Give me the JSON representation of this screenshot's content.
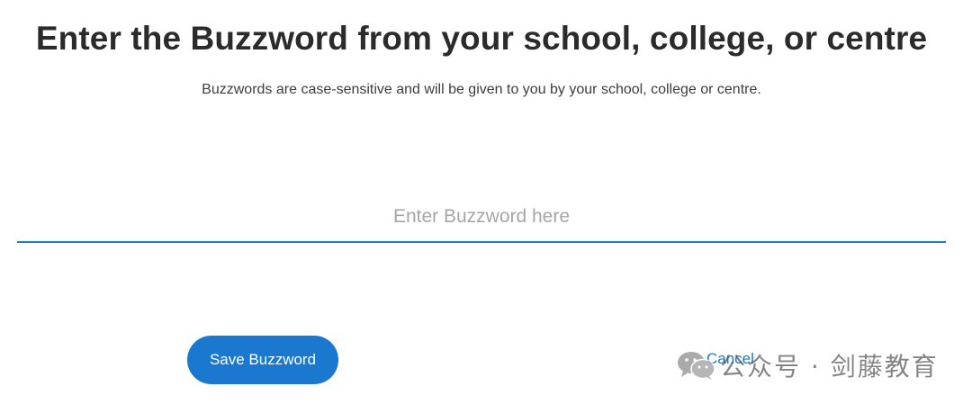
{
  "header": {
    "title": "Enter the Buzzword from your school, college, or centre",
    "subtitle": "Buzzwords are case-sensitive and will be given to you by your school, college or centre."
  },
  "form": {
    "buzzword_input": {
      "value": "",
      "placeholder": "Enter Buzzword here"
    },
    "save_label": "Save Buzzword",
    "cancel_label": "Cancel"
  },
  "watermark": {
    "icon": "wechat-icon",
    "text": "公众号 · 剑藤教育"
  },
  "colors": {
    "accent": "#1a78cf",
    "title": "#2b2b2b",
    "placeholder": "#a6a6a6"
  }
}
